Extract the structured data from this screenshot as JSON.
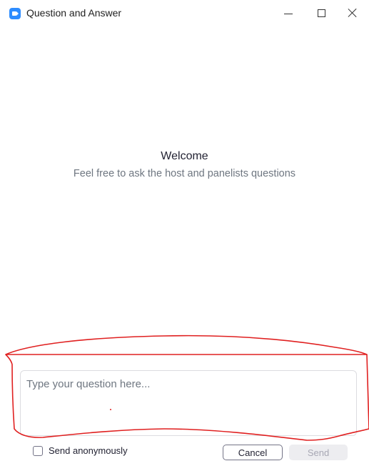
{
  "window": {
    "title": "Question and Answer"
  },
  "icons": {
    "app": "zoom-camera-icon",
    "minimize": "minimize-icon",
    "maximize": "maximize-icon",
    "close": "close-icon",
    "checkbox": "checkbox-icon"
  },
  "welcome": {
    "title": "Welcome",
    "subtitle": "Feel free to ask the host and panelists questions"
  },
  "question": {
    "placeholder": "Type your question here...",
    "value": ""
  },
  "controls": {
    "anonymous_label": "Send anonymously",
    "anonymous_checked": false,
    "cancel_label": "Cancel",
    "send_label": "Send",
    "send_enabled": false
  },
  "colors": {
    "brand": "#2d8cff",
    "annotation": "#e02020",
    "muted_text": "#6e7680",
    "disabled_bg": "#ededf0"
  }
}
